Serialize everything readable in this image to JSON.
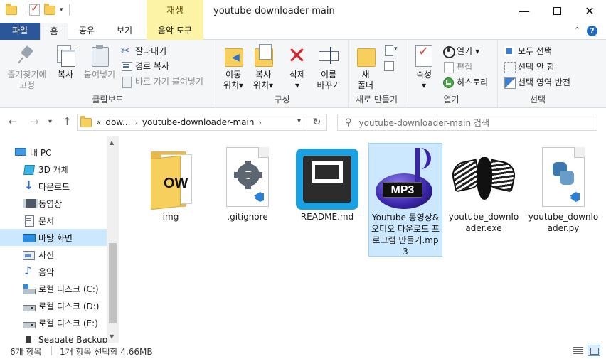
{
  "titlebar": {
    "context_tab_header": "재생",
    "title": "youtube-downloader-main",
    "minimize": "—",
    "close": "✕"
  },
  "ribbon_tabs": {
    "file": "파일",
    "home": "홈",
    "share": "공유",
    "view": "보기",
    "music_tools": "음악 도구",
    "help": "?",
    "collapse": "⌃"
  },
  "ribbon": {
    "clipboard": {
      "pin_line1": "즐겨찾기에",
      "pin_line2": "고정",
      "copy": "복사",
      "paste": "붙여넣기",
      "cut": "잘라내기",
      "copy_path": "경로 복사",
      "paste_shortcut": "바로 가기 붙여넣기",
      "label": "클립보드"
    },
    "organize": {
      "move_line1": "이동",
      "move_line2": "위치",
      "copy_line1": "복사",
      "copy_line2": "위치",
      "delete": "삭제",
      "rename_line1": "이름",
      "rename_line2": "바꾸기",
      "label": "구성"
    },
    "new": {
      "new_line1": "새",
      "new_line2": "폴더",
      "label": "새로 만들기"
    },
    "open": {
      "properties": "속성",
      "open": "열기",
      "edit": "편집",
      "history": "히스토리",
      "label": "열기"
    },
    "select": {
      "select_all": "모두 선택",
      "select_none": "선택 안 함",
      "invert": "선택 영역 반전",
      "label": "선택"
    },
    "dropdown_marker": "▾"
  },
  "address": {
    "overflow": "«",
    "crumb1": "dow...",
    "crumb2": "youtube-downloader-main",
    "sep": "›",
    "refresh": "↻",
    "search_placeholder": "youtube-downloader-main 검색"
  },
  "nav_pane": {
    "items": [
      {
        "label": "내 PC",
        "icon": "pc-icon"
      },
      {
        "label": "3D 개체",
        "icon": "3d-objects-icon"
      },
      {
        "label": "다운로드",
        "icon": "downloads-icon"
      },
      {
        "label": "동영상",
        "icon": "videos-icon"
      },
      {
        "label": "문서",
        "icon": "documents-icon"
      },
      {
        "label": "바탕 화면",
        "icon": "desktop-icon"
      },
      {
        "label": "사진",
        "icon": "pictures-icon"
      },
      {
        "label": "음악",
        "icon": "music-icon"
      },
      {
        "label": "로컬 디스크 (C:)",
        "icon": "drive-c-icon"
      },
      {
        "label": "로컬 디스크 (D:)",
        "icon": "drive-icon"
      },
      {
        "label": "로컬 디스크 (E:)",
        "icon": "drive-icon"
      },
      {
        "label": "Seagate Backup P",
        "icon": "external-drive-icon"
      }
    ]
  },
  "files": [
    {
      "name": "img",
      "type": "folder",
      "selected": false
    },
    {
      "name": ".gitignore",
      "type": "gitignore",
      "selected": false
    },
    {
      "name": "README.md",
      "type": "markdown",
      "selected": false
    },
    {
      "name": "Youtube 동영상&오디오 다운로드 프로그램 만들기.mp3",
      "type": "mp3",
      "selected": true
    },
    {
      "name": "youtube_downloader.exe",
      "type": "exe",
      "selected": false
    },
    {
      "name": "youtube_downloader.py",
      "type": "py",
      "selected": false
    }
  ],
  "thumbnail_text": {
    "folder_badge": "OW",
    "mp3_badge": "MP3"
  },
  "status": {
    "item_count": "6개 항목",
    "selection": "1개 항목 선택함 4.66MB"
  },
  "colors": {
    "file_tab": "#2b579a",
    "context_tab": "#fdf3a7",
    "selection": "#cce8ff"
  }
}
